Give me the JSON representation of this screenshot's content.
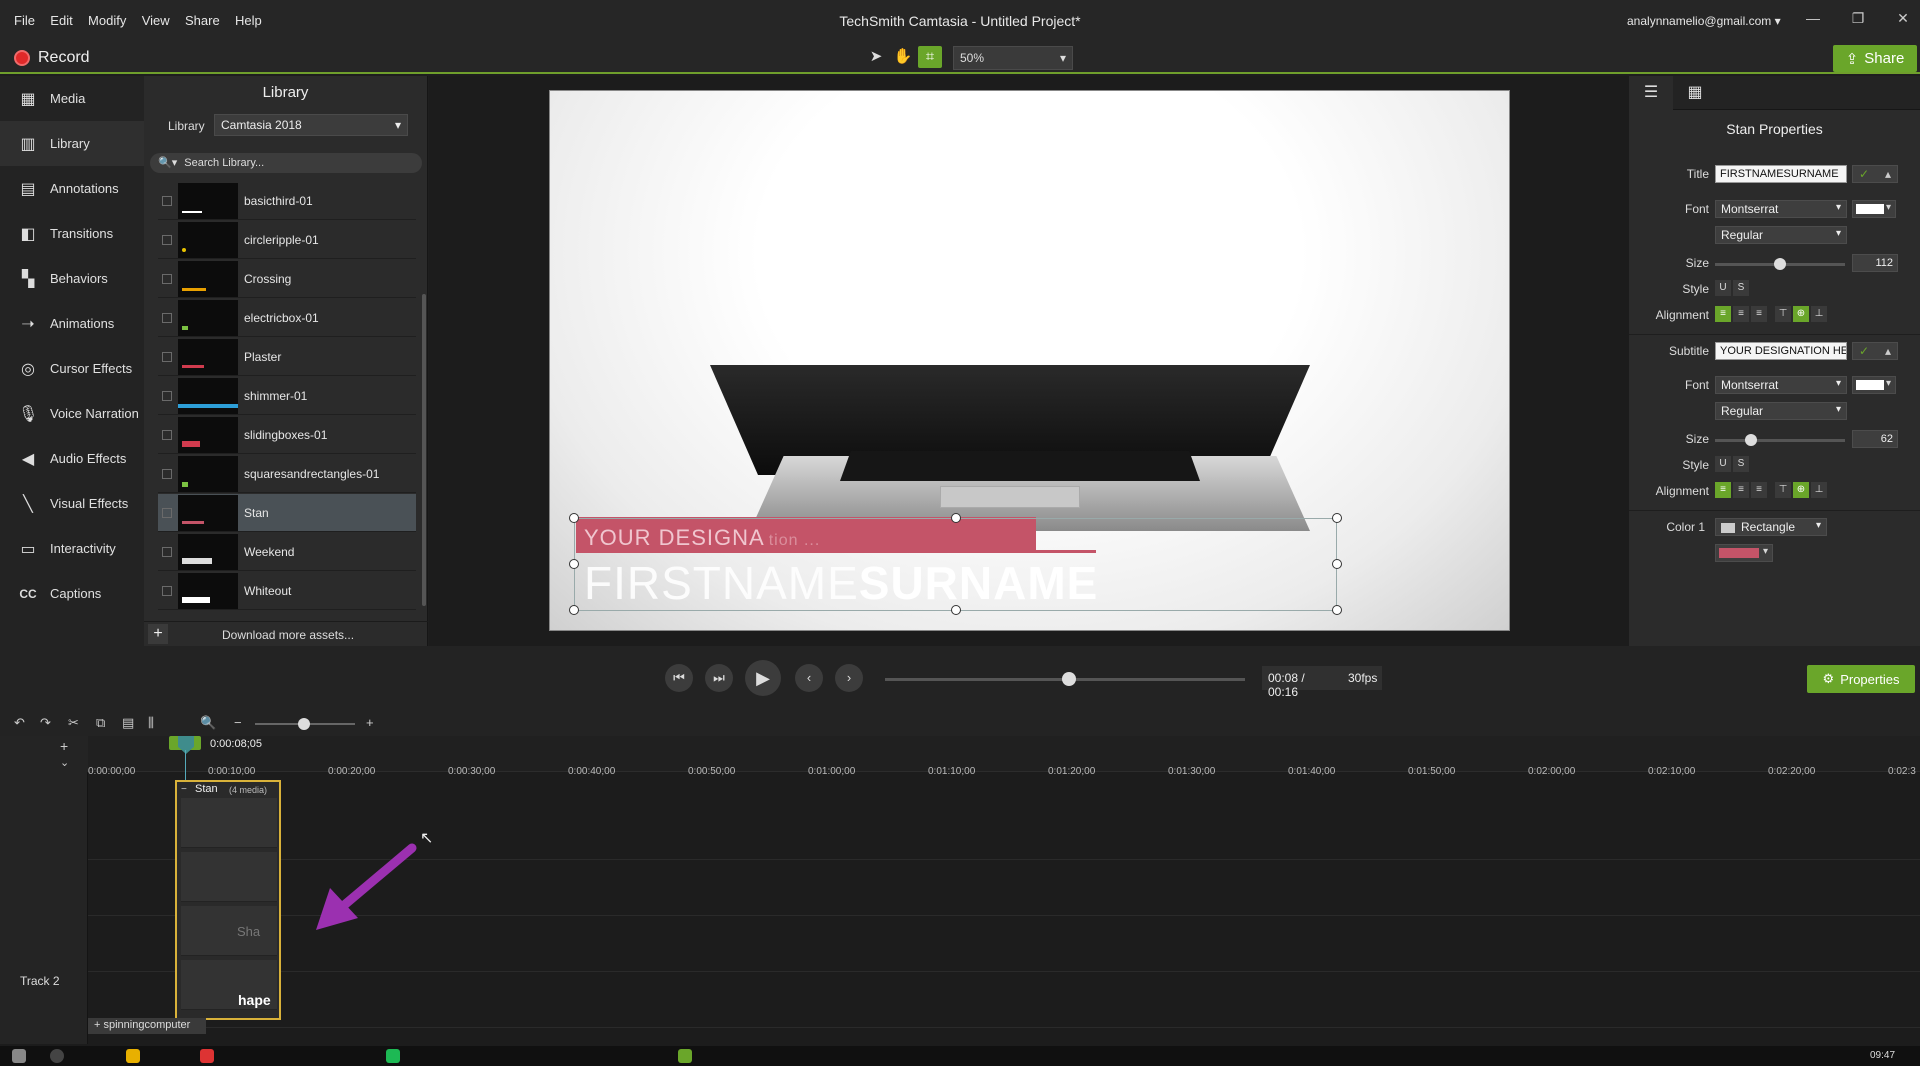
{
  "menu": [
    "File",
    "Edit",
    "Modify",
    "View",
    "Share",
    "Help"
  ],
  "app_title": "TechSmith Camtasia - Untitled Project*",
  "account": "analynnamelio@gmail.com ▾",
  "record_label": "Record",
  "zoom_value": "50%",
  "share_label": "Share",
  "sidebar": [
    {
      "label": "Media",
      "icon": "▦"
    },
    {
      "label": "Library",
      "icon": "▥"
    },
    {
      "label": "Annotations",
      "icon": "▤"
    },
    {
      "label": "Transitions",
      "icon": "◧"
    },
    {
      "label": "Behaviors",
      "icon": "▚"
    },
    {
      "label": "Animations",
      "icon": "➝"
    },
    {
      "label": "Cursor Effects",
      "icon": "◎"
    },
    {
      "label": "Voice Narration",
      "icon": "🎙"
    },
    {
      "label": "Audio Effects",
      "icon": "◀"
    },
    {
      "label": "Visual Effects",
      "icon": "╲"
    },
    {
      "label": "Interactivity",
      "icon": "▭"
    },
    {
      "label": "Captions",
      "icon": "CC"
    }
  ],
  "library": {
    "title": "Library",
    "select_label": "Library",
    "select_value": "Camtasia 2018",
    "search_placeholder": "Search Library...",
    "items": [
      "basicthird-01",
      "circleripple-01",
      "Crossing",
      "electricbox-01",
      "Plaster",
      "shimmer-01",
      "slidingboxes-01",
      "squaresandrectangles-01",
      "Stan",
      "Weekend",
      "Whiteout"
    ],
    "selected": "Stan",
    "download_label": "Download more assets..."
  },
  "canvas": {
    "designation_text": "YOUR DESIGNA",
    "designation_faded": "tion ...",
    "first_name": "FIRSTNAME",
    "last_name": "SURNAME"
  },
  "properties": {
    "title": "Stan Properties",
    "title_label": "Title",
    "title_value": "FIRSTNAMESURNAME",
    "font_label": "Font",
    "font_value": "Montserrat",
    "weight_value": "Regular",
    "size_label": "Size",
    "title_size": "112",
    "title_size_level": 0.5,
    "style_label": "Style",
    "alignment_label": "Alignment",
    "subtitle_label": "Subtitle",
    "subtitle_value": "YOUR DESIGNATION HER",
    "subtitle_font": "Montserrat",
    "subtitle_weight": "Regular",
    "subtitle_size": "62",
    "subtitle_size_level": 0.25,
    "color1_label": "Color 1",
    "color1_value": "Rectangle",
    "accent_color": "#c45468"
  },
  "transport": {
    "timecode": "00:08 / 00:16",
    "fps": "30fps",
    "properties_label": "Properties"
  },
  "timeline": {
    "playhead_time": "0:00:08;05",
    "ticks": [
      "0:00:00;00",
      "0:00:10;00",
      "0:00:20;00",
      "0:00:30;00",
      "0:00:40;00",
      "0:00:50;00",
      "0:01:00;00",
      "0:01:10;00",
      "0:01:20;00",
      "0:01:30;00",
      "0:01:40;00",
      "0:01:50;00",
      "0:02:00;00",
      "0:02:10;00",
      "0:02:20;00",
      "0:02:3"
    ],
    "track2_label": "Track 2",
    "group_label": "Stan",
    "group_count": "(4 media)",
    "clip_label_a": "Sha",
    "clip_label_b": "hape",
    "media_chip": "+ spinningcomputer"
  },
  "clock": "09:47"
}
